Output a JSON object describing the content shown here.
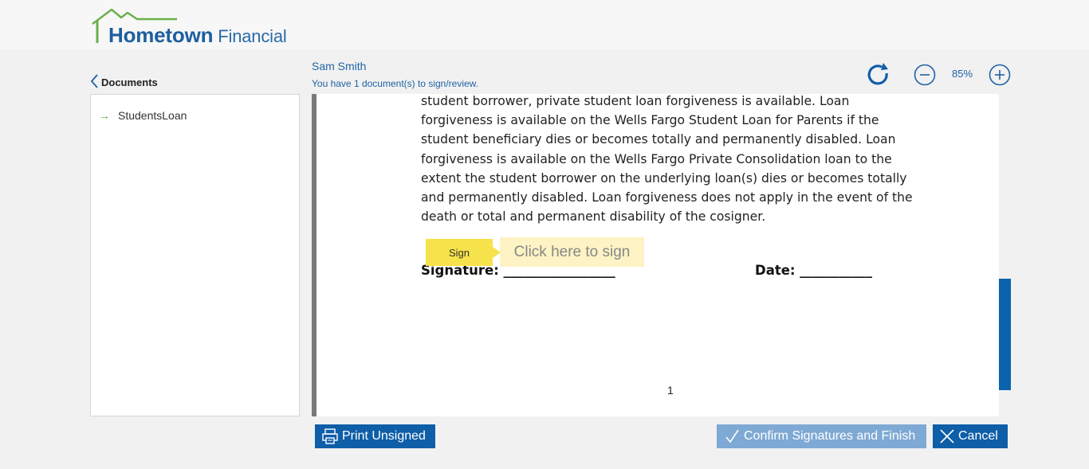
{
  "brand": {
    "name_bold": "Hometown",
    "name_light": "Financial",
    "colors": {
      "primary": "#1d5f9e",
      "roof_green": "#6ab04c",
      "sign_yellow": "#f6e24a"
    }
  },
  "sidebar": {
    "back_label": "Documents",
    "items": [
      {
        "label": "StudentsLoan",
        "icon": "arrow-right-icon"
      }
    ]
  },
  "user": {
    "name": "Sam Smith",
    "message": "You have 1 document(s) to sign/review."
  },
  "toolbar": {
    "zoom": "85%",
    "icons": [
      "refresh-icon",
      "zoom-out-icon",
      "zoom-in-icon"
    ]
  },
  "document": {
    "lines": [
      "student borrower, private student loan forgiveness is available. Loan",
      "forgiveness is available on the Wells Fargo Student Loan for Parents if the",
      "student beneficiary dies or becomes totally and permanently disabled. Loan",
      "forgiveness is available on the Wells Fargo Private Consolidation loan to the",
      "extent the student borrower on the underlying loan(s) dies or becomes totally",
      "and permanently disabled. Loan forgiveness does not apply in the event of the",
      "death or total and permanent disability of the cosigner."
    ],
    "sign_tag": "Sign",
    "sign_hint": "Click here to sign",
    "signature_label": "Signature: _________________",
    "date_label": "Date: ___________",
    "page_number": "1"
  },
  "actions": {
    "print_label": "Print Unsigned",
    "confirm_label": "Confirm Signatures and Finish",
    "cancel_label": "Cancel"
  }
}
